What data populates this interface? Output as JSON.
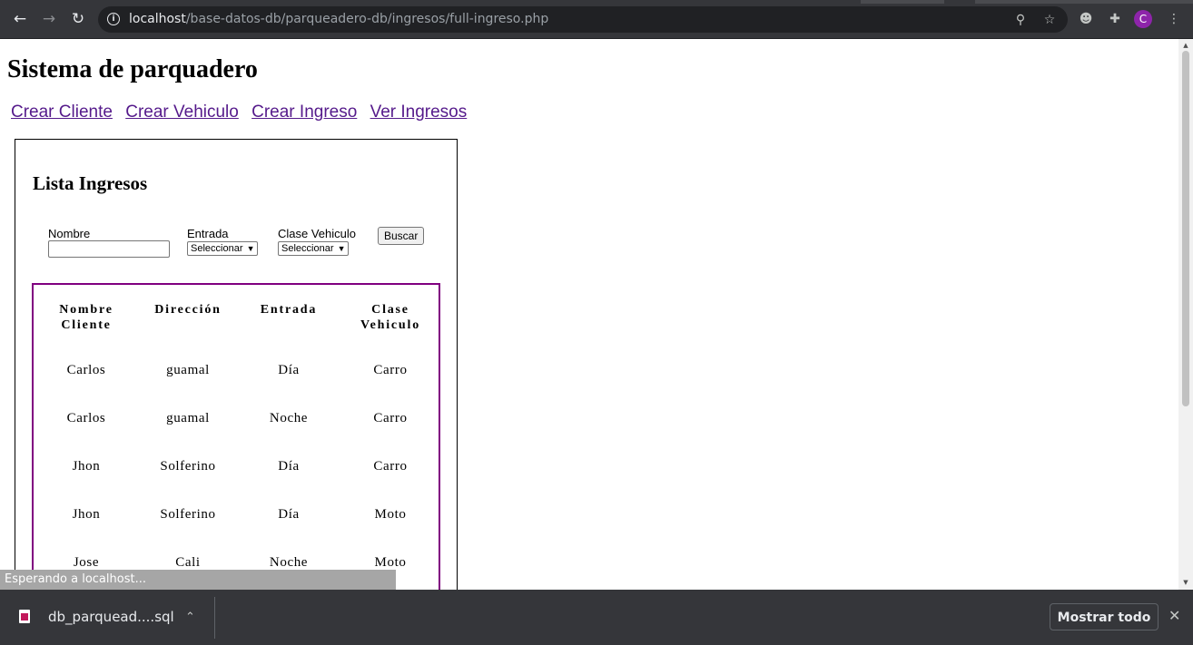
{
  "browser": {
    "url_host": "localhost",
    "url_path": "/base-datos-db/parqueadero-db/ingresos/full-ingreso.php",
    "profile_initial": "C",
    "icons": [
      "back-icon",
      "forward-icon",
      "reload-icon",
      "info-icon",
      "zoom-icon",
      "star-icon",
      "extension-cat-icon",
      "puzzle-icon",
      "menu-icon"
    ]
  },
  "page": {
    "title": "Sistema de parquadero",
    "nav": [
      "Crear Cliente",
      "Crear Vehiculo",
      "Crear Ingreso",
      "Ver Ingresos"
    ],
    "link_color": "#551a8b"
  },
  "panel": {
    "title": "Lista Ingresos",
    "filters": {
      "nombre_label": "Nombre",
      "nombre_value": "",
      "entrada_label": "Entrada",
      "entrada_selected": "Seleccionar",
      "clase_label": "Clase Vehiculo",
      "clase_selected": "Seleccionar",
      "search_button": "Buscar"
    },
    "table": {
      "border_color": "#800080",
      "headers": [
        "Nombre Cliente",
        "Dirección",
        "Entrada",
        "Clase Vehiculo"
      ],
      "rows": [
        [
          "Carlos",
          "guamal",
          "Día",
          "Carro"
        ],
        [
          "Carlos",
          "guamal",
          "Noche",
          "Carro"
        ],
        [
          "Jhon",
          "Solferino",
          "Día",
          "Carro"
        ],
        [
          "Jhon",
          "Solferino",
          "Día",
          "Moto"
        ],
        [
          "Jose",
          "Cali",
          "Noche",
          "Moto"
        ]
      ]
    }
  },
  "status_text": "Esperando a localhost...",
  "download": {
    "file_name": "db_parquead....sql",
    "show_all": "Mostrar todo"
  }
}
